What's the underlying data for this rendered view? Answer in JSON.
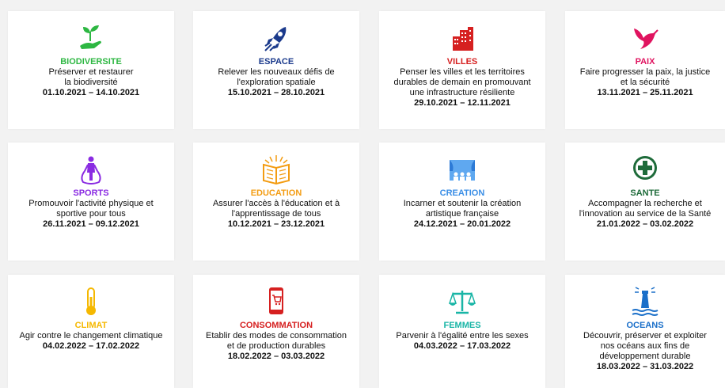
{
  "themes": [
    {
      "title": "BIODIVERSITE",
      "color": "#2db742",
      "desc": [
        "Préserver et restaurer",
        "la biodiversité"
      ],
      "dates": "01.10.2021 – 14.10.2021",
      "icon": "hand-plant-icon"
    },
    {
      "title": "ESPACE",
      "color": "#1b3a8c",
      "desc": [
        "Relever les nouveaux défis de",
        "l'exploration spatiale"
      ],
      "dates": "15.10.2021 – 28.10.2021",
      "icon": "rocket-icon"
    },
    {
      "title": "VILLES",
      "color": "#d62020",
      "desc": [
        "Penser les villes et les territoires",
        "durables de demain en promouvant",
        "une infrastructure résiliente"
      ],
      "dates": "29.10.2021 – 12.11.2021",
      "icon": "city-buildings-icon"
    },
    {
      "title": "PAIX",
      "color": "#e0135f",
      "desc": [
        "Faire progresser la paix, la justice",
        "et la sécurité"
      ],
      "dates": "13.11.2021 – 25.11.2021",
      "icon": "dove-icon"
    },
    {
      "title": "SPORTS",
      "color": "#8a2be2",
      "desc": [
        "Promouvoir l'activité physique et",
        "sportive pour tous"
      ],
      "dates": "26.11.2021 – 09.12.2021",
      "icon": "jump-rope-icon"
    },
    {
      "title": "EDUCATION",
      "color": "#f39c12",
      "desc": [
        "Assurer l'accès à l'éducation et à",
        "l'apprentissage de tous"
      ],
      "dates": "10.12.2021 – 23.12.2021",
      "icon": "open-book-icon"
    },
    {
      "title": "CREATION",
      "color": "#3a8ee6",
      "desc": [
        "Incarner et soutenir la création",
        "artistique française"
      ],
      "dates": "24.12.2021 – 20.01.2022",
      "icon": "stage-audience-icon"
    },
    {
      "title": "SANTE",
      "color": "#1e6b3a",
      "desc": [
        "Accompagner la recherche et",
        "l'innovation au service de la Santé"
      ],
      "dates": "21.01.2022 – 03.02.2022",
      "icon": "medical-cross-icon"
    },
    {
      "title": "CLIMAT",
      "color": "#f5b800",
      "desc": [
        "Agir contre le changement climatique"
      ],
      "dates": "04.02.2022 – 17.02.2022",
      "icon": "thermometer-icon"
    },
    {
      "title": "CONSOMMATION",
      "color": "#d62020",
      "desc": [
        "Etablir des modes de consommation",
        "et de production durables"
      ],
      "dates": "18.02.2022 – 03.03.2022",
      "icon": "phone-cart-icon"
    },
    {
      "title": "FEMMES",
      "color": "#19b5a6",
      "desc": [
        "Parvenir à l'égalité entre les sexes"
      ],
      "dates": "04.03.2022 – 17.03.2022",
      "icon": "scales-icon"
    },
    {
      "title": "OCEANS",
      "color": "#1a6fc9",
      "desc": [
        "Découvrir, préserver et exploiter",
        "nos océans aux fins de",
        "développement durable"
      ],
      "dates": "18.03.2022 – 31.03.2022",
      "icon": "lighthouse-icon"
    }
  ]
}
